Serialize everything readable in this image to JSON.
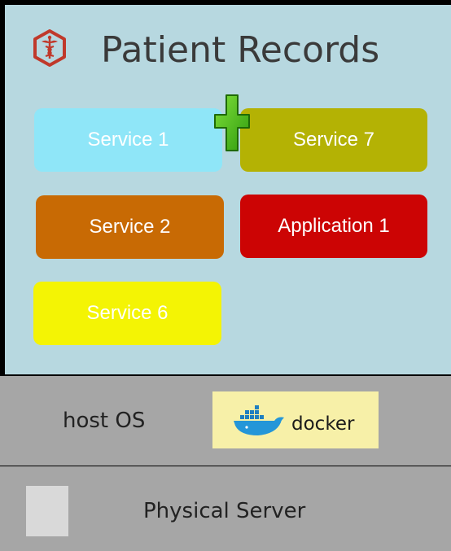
{
  "header": {
    "title": "Patient Records",
    "logo_icon": "caduceus-icon",
    "accent": "#c0392b"
  },
  "services": {
    "svc1": "Service 1",
    "svc7": "Service 7",
    "svc2": "Service 2",
    "app1": "Application 1",
    "svc6": "Service 6"
  },
  "add_icon": "plus-icon",
  "host": {
    "label": "host OS",
    "engine": "docker",
    "engine_icon": "docker-whale-icon"
  },
  "server": {
    "label": "Physical Server"
  },
  "colors": {
    "app_layer": "#b7d8e0",
    "infra_layer": "#a6a6a6",
    "service1": "#8fe6f8",
    "service7": "#b4b204",
    "service2": "#c86a04",
    "application1": "#cc0404",
    "service6": "#f4f404",
    "plus": "#5cc41a"
  }
}
